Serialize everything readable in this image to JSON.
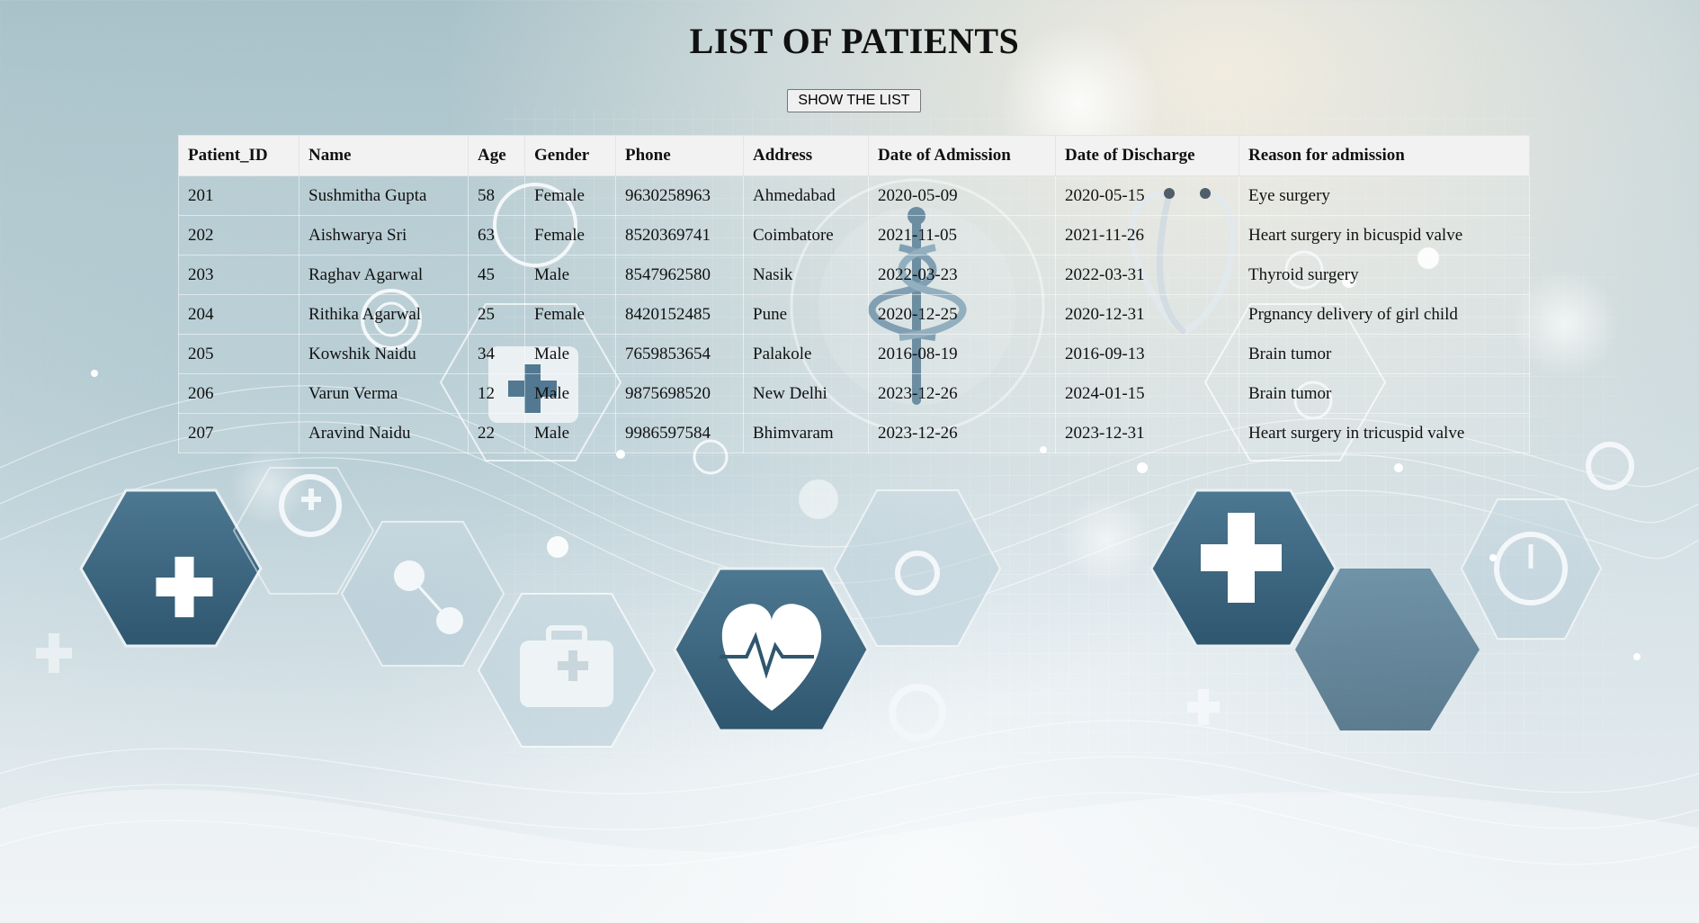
{
  "page": {
    "title": "LIST OF PATIENTS",
    "show_button_label": "SHOW THE LIST"
  },
  "table": {
    "headers": [
      "Patient_ID",
      "Name",
      "Age",
      "Gender",
      "Phone",
      "Address",
      "Date of Admission",
      "Date of Discharge",
      "Reason for admission"
    ],
    "rows": [
      [
        "201",
        "Sushmitha Gupta",
        "58",
        "Female",
        "9630258963",
        "Ahmedabad",
        "2020-05-09",
        "2020-05-15",
        "Eye surgery"
      ],
      [
        "202",
        "Aishwarya Sri",
        "63",
        "Female",
        "8520369741",
        "Coimbatore",
        "2021-11-05",
        "2021-11-26",
        "Heart surgery in bicuspid valve"
      ],
      [
        "203",
        "Raghav Agarwal",
        "45",
        "Male",
        "8547962580",
        "Nasik",
        "2022-03-23",
        "2022-03-31",
        "Thyroid surgery"
      ],
      [
        "204",
        "Rithika Agarwal",
        "25",
        "Female",
        "8420152485",
        "Pune",
        "2020-12-25",
        "2020-12-31",
        "Prgnancy delivery of girl child"
      ],
      [
        "205",
        "Kowshik Naidu",
        "34",
        "Male",
        "7659853654",
        "Palakole",
        "2016-08-19",
        "2016-09-13",
        "Brain tumor"
      ],
      [
        "206",
        "Varun Verma",
        "12",
        "Male",
        "9875698520",
        "New Delhi",
        "2023-12-26",
        "2024-01-15",
        "Brain tumor"
      ],
      [
        "207",
        "Aravind Naidu",
        "22",
        "Male",
        "9986597584",
        "Bhimvaram",
        "2023-12-26",
        "2023-12-31",
        "Heart surgery in tricuspid valve"
      ]
    ]
  },
  "background": {
    "icons": [
      "medical-cross-icon",
      "first-aid-kit-icon",
      "heartbeat-icon",
      "stethoscope-icon",
      "caduceus-icon",
      "molecule-icon",
      "clock-icon"
    ],
    "colors": {
      "hexagon_dark": "#3f6a85",
      "hexagon_light": "#dbe6ec",
      "accent_white": "#ffffff"
    }
  }
}
